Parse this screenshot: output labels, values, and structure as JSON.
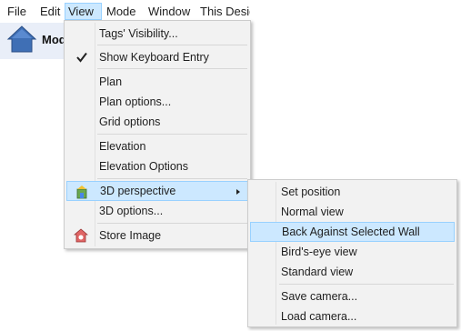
{
  "menubar": {
    "items": [
      {
        "label": "File"
      },
      {
        "label": "Edit"
      },
      {
        "label": "View"
      },
      {
        "label": "Mode"
      },
      {
        "label": "Window"
      },
      {
        "label": "This Desig"
      }
    ]
  },
  "toolbar": {
    "partial_label": "Mod"
  },
  "view_menu": {
    "items": [
      {
        "label": "Tags' Visibility..."
      },
      {
        "label": "Show Keyboard Entry",
        "checked": true
      },
      {
        "label": "Plan"
      },
      {
        "label": "Plan options..."
      },
      {
        "label": "Grid options"
      },
      {
        "label": "Elevation"
      },
      {
        "label": "Elevation Options"
      },
      {
        "label": "3D perspective",
        "submenu": true,
        "icon": "perspective-icon"
      },
      {
        "label": "3D options..."
      },
      {
        "label": "Store Image",
        "icon": "store-image-icon"
      }
    ]
  },
  "perspective_submenu": {
    "items": [
      {
        "label": "Set position"
      },
      {
        "label": "Normal view"
      },
      {
        "label": "Back Against Selected Wall"
      },
      {
        "label": "Bird's-eye view"
      },
      {
        "label": "Standard view"
      },
      {
        "label": "Save camera..."
      },
      {
        "label": "Load camera..."
      }
    ]
  },
  "colors": {
    "highlight": "#cce8ff",
    "highlight_border": "#99d1ff",
    "menu_bg": "#f2f2f2"
  }
}
